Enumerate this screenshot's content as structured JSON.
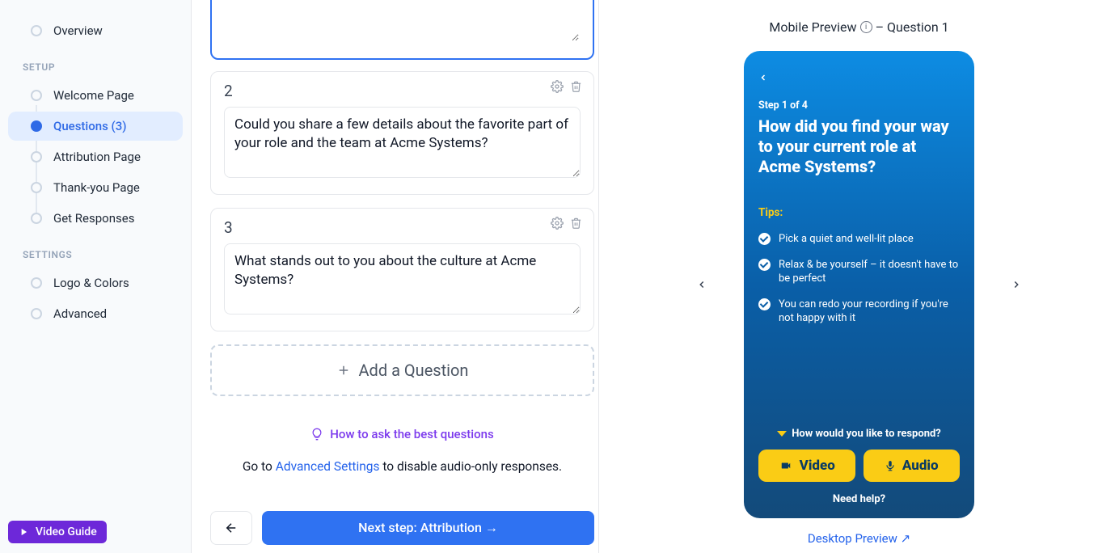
{
  "sidebar": {
    "overview": "Overview",
    "setup_label": "SETUP",
    "setup_items": [
      "Welcome Page",
      "Questions (3)",
      "Attribution Page",
      "Thank-you Page",
      "Get Responses"
    ],
    "settings_label": "SETTINGS",
    "settings_items": [
      "Logo & Colors",
      "Advanced"
    ],
    "video_guide": "Video Guide"
  },
  "editor": {
    "q2_num": "2",
    "q2_text": "Could you share a few details about the favorite part of your role and the team at Acme Systems?",
    "q3_num": "3",
    "q3_text": "What stands out to you about the culture at Acme Systems?",
    "add_question": "Add a Question",
    "hint_link": "How to ask the best questions",
    "disable_prefix": "Go to ",
    "disable_link": "Advanced Settings",
    "disable_suffix": " to disable audio-only responses.",
    "next_step": "Next step: Attribution →"
  },
  "preview": {
    "header_prefix": "Mobile Preview",
    "header_suffix": "– Question 1",
    "step": "Step 1 of 4",
    "question": "How did you find your way to your current role at Acme Systems?",
    "tips_label": "Tips:",
    "tips": [
      "Pick a quiet and well-lit place",
      "Relax & be yourself – it doesn't have to be perfect",
      "You can redo your recording if you're not happy with it"
    ],
    "respond_label": "How would you like to respond?",
    "video_btn": "Video",
    "audio_btn": "Audio",
    "need_help": "Need help?",
    "desktop_preview": "Desktop Preview  ↗"
  }
}
